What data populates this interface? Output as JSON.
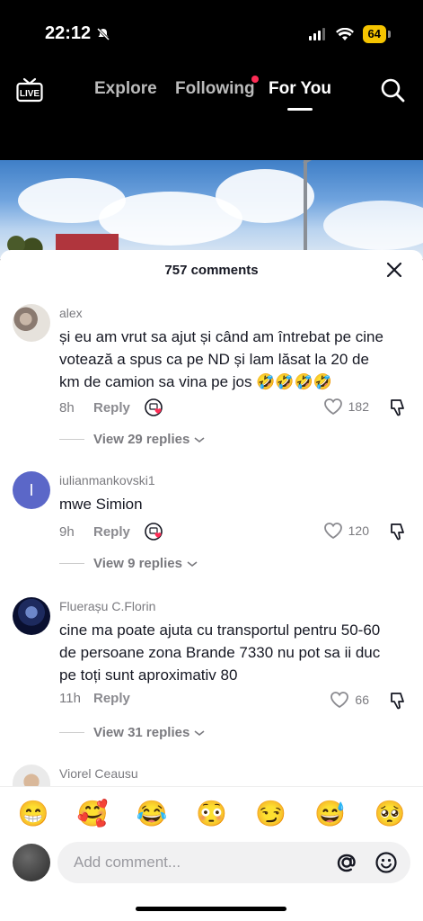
{
  "status_bar": {
    "time": "22:12",
    "battery": "64"
  },
  "nav": {
    "live_label": "LIVE",
    "tabs": [
      {
        "label": "Explore"
      },
      {
        "label": "Following"
      },
      {
        "label": "For You"
      }
    ]
  },
  "sheet": {
    "title": "757 comments",
    "comments": [
      {
        "username": "alex",
        "text": "și eu am vrut sa ajut și când am întrebat pe cine votează a spus ca pe ND și lam lăsat la 20 de km de camion sa vina pe jos 🤣🤣🤣🤣",
        "time": "8h",
        "reply": "Reply",
        "likes": "182",
        "view_replies": "View 29 replies"
      },
      {
        "username": "iulianmankovski1",
        "avatar_letter": "I",
        "text": "mwe Simion",
        "time": "9h",
        "reply": "Reply",
        "likes": "120",
        "view_replies": "View 9 replies"
      },
      {
        "username": "Fluerașu C.Florin",
        "text": "cine ma poate ajuta cu transportul pentru 50-60 de persoane zona Brande 7330 nu pot sa ii duc pe toți sunt aproximativ 80",
        "time": "11h",
        "reply": "Reply",
        "likes": "66",
        "view_replies": "View 31 replies"
      },
      {
        "username": "Viorel Ceausu"
      }
    ]
  },
  "emoji_bar": [
    "😁",
    "🥰",
    "😂",
    "😳",
    "😏",
    "😅",
    "🥺"
  ],
  "composer": {
    "placeholder": "Add comment..."
  },
  "colors": {
    "accent": "#fe2c55",
    "avatar_purple": "#5b67c8",
    "battery": "#f5c400"
  }
}
